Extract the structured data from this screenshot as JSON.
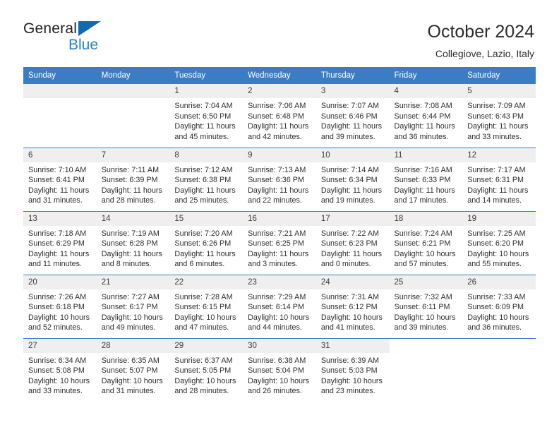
{
  "brand": {
    "name_part1": "General",
    "name_part2": "Blue"
  },
  "header": {
    "title": "October 2024",
    "subtitle": "Collegiove, Lazio, Italy"
  },
  "calendar": {
    "weekday_headers": [
      "Sunday",
      "Monday",
      "Tuesday",
      "Wednesday",
      "Thursday",
      "Friday",
      "Saturday"
    ],
    "accent_color": "#3b7dc4",
    "daynum_band_color": "#efefef",
    "weeks": [
      [
        {
          "day": "",
          "blank": true
        },
        {
          "day": "",
          "blank": true
        },
        {
          "day": "1",
          "sunrise": "Sunrise: 7:04 AM",
          "sunset": "Sunset: 6:50 PM",
          "daylight_l1": "Daylight: 11 hours",
          "daylight_l2": "and 45 minutes."
        },
        {
          "day": "2",
          "sunrise": "Sunrise: 7:06 AM",
          "sunset": "Sunset: 6:48 PM",
          "daylight_l1": "Daylight: 11 hours",
          "daylight_l2": "and 42 minutes."
        },
        {
          "day": "3",
          "sunrise": "Sunrise: 7:07 AM",
          "sunset": "Sunset: 6:46 PM",
          "daylight_l1": "Daylight: 11 hours",
          "daylight_l2": "and 39 minutes."
        },
        {
          "day": "4",
          "sunrise": "Sunrise: 7:08 AM",
          "sunset": "Sunset: 6:44 PM",
          "daylight_l1": "Daylight: 11 hours",
          "daylight_l2": "and 36 minutes."
        },
        {
          "day": "5",
          "sunrise": "Sunrise: 7:09 AM",
          "sunset": "Sunset: 6:43 PM",
          "daylight_l1": "Daylight: 11 hours",
          "daylight_l2": "and 33 minutes."
        }
      ],
      [
        {
          "day": "6",
          "sunrise": "Sunrise: 7:10 AM",
          "sunset": "Sunset: 6:41 PM",
          "daylight_l1": "Daylight: 11 hours",
          "daylight_l2": "and 31 minutes."
        },
        {
          "day": "7",
          "sunrise": "Sunrise: 7:11 AM",
          "sunset": "Sunset: 6:39 PM",
          "daylight_l1": "Daylight: 11 hours",
          "daylight_l2": "and 28 minutes."
        },
        {
          "day": "8",
          "sunrise": "Sunrise: 7:12 AM",
          "sunset": "Sunset: 6:38 PM",
          "daylight_l1": "Daylight: 11 hours",
          "daylight_l2": "and 25 minutes."
        },
        {
          "day": "9",
          "sunrise": "Sunrise: 7:13 AM",
          "sunset": "Sunset: 6:36 PM",
          "daylight_l1": "Daylight: 11 hours",
          "daylight_l2": "and 22 minutes."
        },
        {
          "day": "10",
          "sunrise": "Sunrise: 7:14 AM",
          "sunset": "Sunset: 6:34 PM",
          "daylight_l1": "Daylight: 11 hours",
          "daylight_l2": "and 19 minutes."
        },
        {
          "day": "11",
          "sunrise": "Sunrise: 7:16 AM",
          "sunset": "Sunset: 6:33 PM",
          "daylight_l1": "Daylight: 11 hours",
          "daylight_l2": "and 17 minutes."
        },
        {
          "day": "12",
          "sunrise": "Sunrise: 7:17 AM",
          "sunset": "Sunset: 6:31 PM",
          "daylight_l1": "Daylight: 11 hours",
          "daylight_l2": "and 14 minutes."
        }
      ],
      [
        {
          "day": "13",
          "sunrise": "Sunrise: 7:18 AM",
          "sunset": "Sunset: 6:29 PM",
          "daylight_l1": "Daylight: 11 hours",
          "daylight_l2": "and 11 minutes."
        },
        {
          "day": "14",
          "sunrise": "Sunrise: 7:19 AM",
          "sunset": "Sunset: 6:28 PM",
          "daylight_l1": "Daylight: 11 hours",
          "daylight_l2": "and 8 minutes."
        },
        {
          "day": "15",
          "sunrise": "Sunrise: 7:20 AM",
          "sunset": "Sunset: 6:26 PM",
          "daylight_l1": "Daylight: 11 hours",
          "daylight_l2": "and 6 minutes."
        },
        {
          "day": "16",
          "sunrise": "Sunrise: 7:21 AM",
          "sunset": "Sunset: 6:25 PM",
          "daylight_l1": "Daylight: 11 hours",
          "daylight_l2": "and 3 minutes."
        },
        {
          "day": "17",
          "sunrise": "Sunrise: 7:22 AM",
          "sunset": "Sunset: 6:23 PM",
          "daylight_l1": "Daylight: 11 hours",
          "daylight_l2": "and 0 minutes."
        },
        {
          "day": "18",
          "sunrise": "Sunrise: 7:24 AM",
          "sunset": "Sunset: 6:21 PM",
          "daylight_l1": "Daylight: 10 hours",
          "daylight_l2": "and 57 minutes."
        },
        {
          "day": "19",
          "sunrise": "Sunrise: 7:25 AM",
          "sunset": "Sunset: 6:20 PM",
          "daylight_l1": "Daylight: 10 hours",
          "daylight_l2": "and 55 minutes."
        }
      ],
      [
        {
          "day": "20",
          "sunrise": "Sunrise: 7:26 AM",
          "sunset": "Sunset: 6:18 PM",
          "daylight_l1": "Daylight: 10 hours",
          "daylight_l2": "and 52 minutes."
        },
        {
          "day": "21",
          "sunrise": "Sunrise: 7:27 AM",
          "sunset": "Sunset: 6:17 PM",
          "daylight_l1": "Daylight: 10 hours",
          "daylight_l2": "and 49 minutes."
        },
        {
          "day": "22",
          "sunrise": "Sunrise: 7:28 AM",
          "sunset": "Sunset: 6:15 PM",
          "daylight_l1": "Daylight: 10 hours",
          "daylight_l2": "and 47 minutes."
        },
        {
          "day": "23",
          "sunrise": "Sunrise: 7:29 AM",
          "sunset": "Sunset: 6:14 PM",
          "daylight_l1": "Daylight: 10 hours",
          "daylight_l2": "and 44 minutes."
        },
        {
          "day": "24",
          "sunrise": "Sunrise: 7:31 AM",
          "sunset": "Sunset: 6:12 PM",
          "daylight_l1": "Daylight: 10 hours",
          "daylight_l2": "and 41 minutes."
        },
        {
          "day": "25",
          "sunrise": "Sunrise: 7:32 AM",
          "sunset": "Sunset: 6:11 PM",
          "daylight_l1": "Daylight: 10 hours",
          "daylight_l2": "and 39 minutes."
        },
        {
          "day": "26",
          "sunrise": "Sunrise: 7:33 AM",
          "sunset": "Sunset: 6:09 PM",
          "daylight_l1": "Daylight: 10 hours",
          "daylight_l2": "and 36 minutes."
        }
      ],
      [
        {
          "day": "27",
          "sunrise": "Sunrise: 6:34 AM",
          "sunset": "Sunset: 5:08 PM",
          "daylight_l1": "Daylight: 10 hours",
          "daylight_l2": "and 33 minutes."
        },
        {
          "day": "28",
          "sunrise": "Sunrise: 6:35 AM",
          "sunset": "Sunset: 5:07 PM",
          "daylight_l1": "Daylight: 10 hours",
          "daylight_l2": "and 31 minutes."
        },
        {
          "day": "29",
          "sunrise": "Sunrise: 6:37 AM",
          "sunset": "Sunset: 5:05 PM",
          "daylight_l1": "Daylight: 10 hours",
          "daylight_l2": "and 28 minutes."
        },
        {
          "day": "30",
          "sunrise": "Sunrise: 6:38 AM",
          "sunset": "Sunset: 5:04 PM",
          "daylight_l1": "Daylight: 10 hours",
          "daylight_l2": "and 26 minutes."
        },
        {
          "day": "31",
          "sunrise": "Sunrise: 6:39 AM",
          "sunset": "Sunset: 5:03 PM",
          "daylight_l1": "Daylight: 10 hours",
          "daylight_l2": "and 23 minutes."
        },
        {
          "day": "",
          "blank": true
        },
        {
          "day": "",
          "blank": true
        }
      ]
    ]
  }
}
